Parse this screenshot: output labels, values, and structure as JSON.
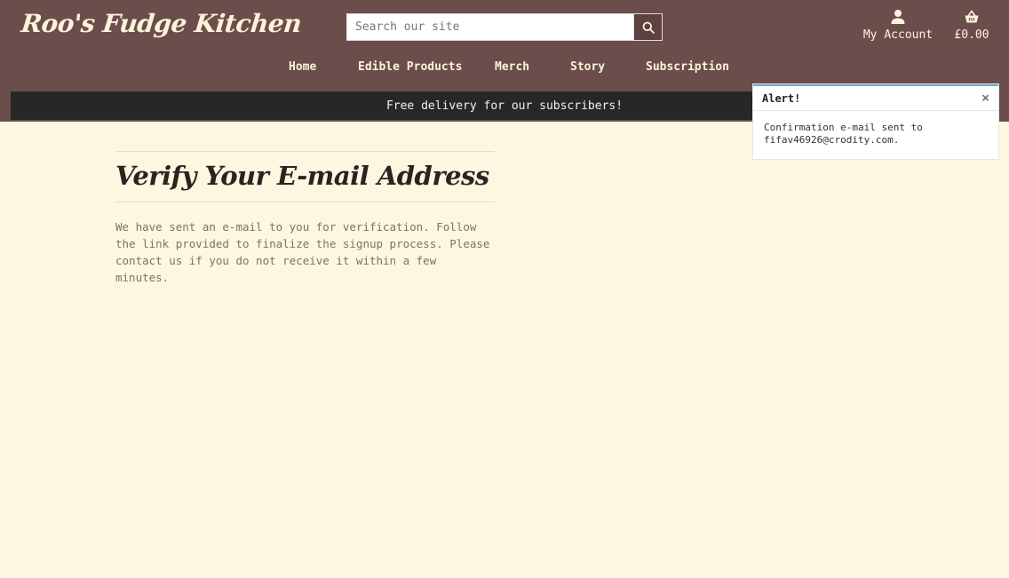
{
  "header": {
    "logo": "Roo's Fudge Kitchen",
    "search_placeholder": "Search our site",
    "account_label": "My Account",
    "basket_total": "£0.00"
  },
  "nav": [
    "Home",
    "Edible Products",
    "Merch",
    "Story",
    "Subscription"
  ],
  "banner": "Free delivery for our subscribers!",
  "main": {
    "title": "Verify Your E-mail Address",
    "body": "We have sent an e-mail to you for verification. Follow the link provided to finalize the signup process. Please contact us if you do not receive it within a few minutes."
  },
  "alert": {
    "title": "Alert!",
    "message": "Confirmation e-mail sent to fifav46926@crodity.com.",
    "close_symbol": "×"
  },
  "icons": {
    "search": "search-icon",
    "account": "user-icon",
    "basket": "basket-icon"
  },
  "colors": {
    "header_bg": "#6b4d4b",
    "banner_bg": "#272727",
    "page_bg": "#fdf6e0",
    "alert_accent": "#6aa8c8"
  }
}
